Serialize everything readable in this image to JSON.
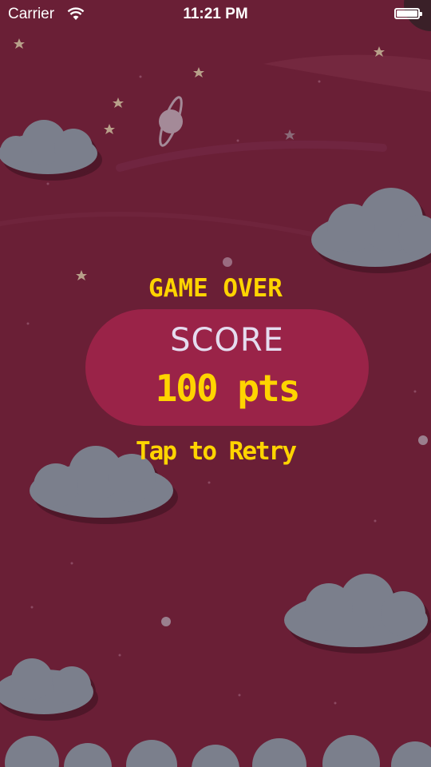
{
  "status_bar": {
    "carrier": "Carrier",
    "time": "11:21 PM",
    "wifi_icon": "wifi-icon",
    "battery_icon": "battery-full-icon"
  },
  "game_over": {
    "title": "GAME OVER",
    "score_label": "SCORE",
    "score_value": "100 pts",
    "retry_label": "Tap to Retry"
  },
  "colors": {
    "background": "#6a1f36",
    "score_panel": "#9a2348",
    "accent_yellow": "#ffd400",
    "score_label": "#e5dcef",
    "cloud": "#7b7f8c",
    "cloud_shadow": "#4f1729",
    "star": "#b8a08a"
  }
}
